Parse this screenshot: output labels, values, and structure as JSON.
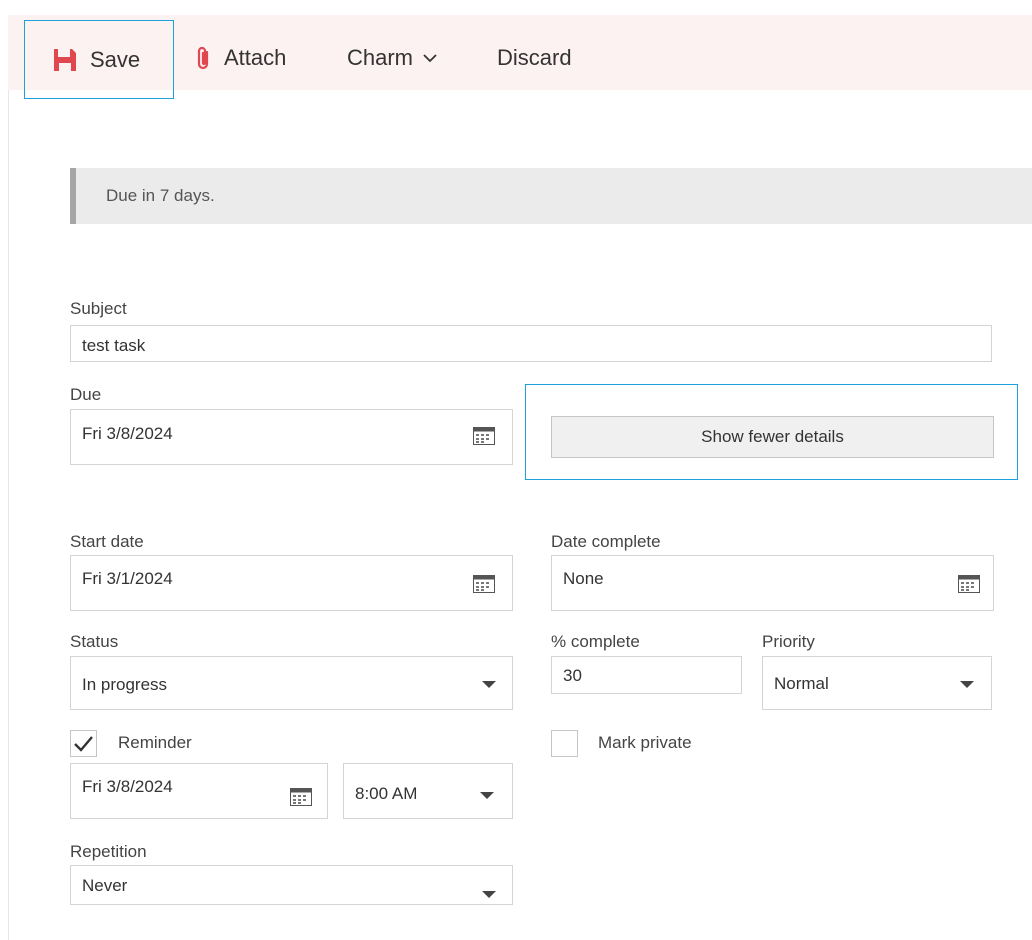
{
  "toolbar": {
    "save_label": "Save",
    "attach_label": "Attach",
    "charm_label": "Charm",
    "discard_label": "Discard",
    "save_icon_color": "#e0474f",
    "attach_icon_color": "#e0474f",
    "focus_color": "#1ea1d8"
  },
  "banner": {
    "text": "Due in 7 days."
  },
  "form": {
    "subject": {
      "label": "Subject",
      "value": "test task"
    },
    "due": {
      "label": "Due",
      "value": "Fri 3/8/2024"
    },
    "show_fewer_label": "Show fewer details",
    "start_date": {
      "label": "Start date",
      "value": "Fri 3/1/2024"
    },
    "date_complete": {
      "label": "Date complete",
      "value": "None"
    },
    "status": {
      "label": "Status",
      "value": "In progress"
    },
    "percent_complete": {
      "label": "% complete",
      "value": "30"
    },
    "priority": {
      "label": "Priority",
      "value": "Normal"
    },
    "reminder": {
      "label": "Reminder",
      "checked": true,
      "date": "Fri 3/8/2024",
      "time": "8:00 AM"
    },
    "mark_private": {
      "label": "Mark private",
      "checked": false
    },
    "repetition": {
      "label": "Repetition",
      "value": "Never"
    }
  }
}
